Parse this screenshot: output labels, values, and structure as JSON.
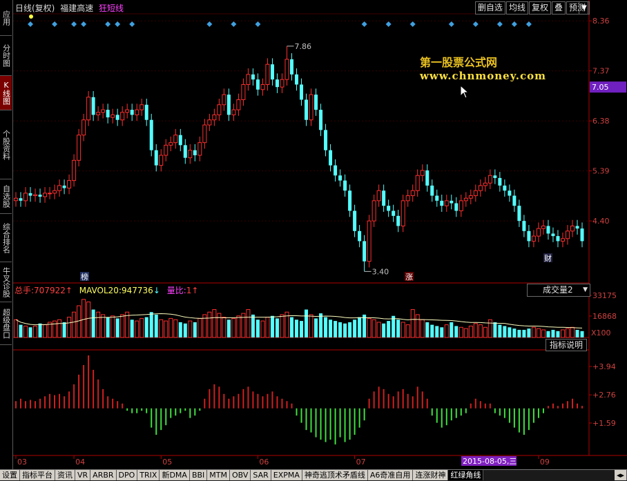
{
  "header": {
    "period": "日线(复权)",
    "stock": "福建高速",
    "indicator": "狂短线",
    "indicator_color": "#ff40ff"
  },
  "toolbar": [
    "删自选",
    "均线",
    "复权",
    "叠",
    "预测"
  ],
  "leftnav": [
    {
      "label": "应用",
      "active": false
    },
    {
      "label": "分时图",
      "active": false
    },
    {
      "label": "K线图",
      "active": true
    },
    {
      "label": "个股资料",
      "active": false
    },
    {
      "label": "自选股",
      "active": false
    },
    {
      "label": "综合排名",
      "active": false
    },
    {
      "label": "牛叉诊股",
      "active": false
    },
    {
      "label": "超级盘口",
      "active": false
    }
  ],
  "watermark": {
    "line1": "第一股票公式网",
    "line2": "www.chnmoney.com"
  },
  "price_axis": [
    "8.36",
    "7.37",
    "6.38",
    "5.39",
    "4.40"
  ],
  "current_price": "7.05",
  "annotations": {
    "high": "7.86",
    "low": "3.40",
    "tag_bang": "榜",
    "tag_zhang": "涨",
    "tag_cai": "财"
  },
  "volume_panel": {
    "total_label": "总手:",
    "total_value": "707922",
    "mavol_label": "MAVOL20:",
    "mavol_value": "947736",
    "ratio_label": "量比:",
    "ratio_value": "1",
    "selector": "成交量2",
    "axis": [
      "33175",
      "16868"
    ],
    "unit": "X100",
    "help_button": "指标说明"
  },
  "indicator_axis": [
    "+3.94",
    "+2.76",
    "+1.59"
  ],
  "x_axis": [
    "03",
    "04",
    "05",
    "06",
    "07",
    "08",
    "09"
  ],
  "cursor_date": "2015-08-05,三",
  "tabs": [
    {
      "label": "设置",
      "active": false
    },
    {
      "label": "指标平台",
      "active": false
    },
    {
      "label": "资讯",
      "active": false
    },
    {
      "label": "VR",
      "active": false
    },
    {
      "label": "ARBR",
      "active": false
    },
    {
      "label": "DPO",
      "active": false
    },
    {
      "label": "TRIX",
      "active": false
    },
    {
      "label": "新DMA",
      "active": false
    },
    {
      "label": "BBI",
      "active": false
    },
    {
      "label": "MTM",
      "active": false
    },
    {
      "label": "OBV",
      "active": false
    },
    {
      "label": "SAR",
      "active": false
    },
    {
      "label": "EXPMA",
      "active": false
    },
    {
      "label": "神奇逃顶术矛盾线",
      "active": false
    },
    {
      "label": "A6奇准自用",
      "active": false
    },
    {
      "label": "连涨财神",
      "active": false
    },
    {
      "label": "红绿角线",
      "active": true
    }
  ],
  "colors": {
    "up": "#ff3030",
    "down": "#54ffff",
    "axis": "#b00000",
    "macd_up": "#d02020",
    "macd_down": "#40e040",
    "diamond": "#40a0e0",
    "ma_line": "#ffffc0"
  },
  "chart_data": {
    "type": "candlestick",
    "ylim": [
      3.2,
      8.5
    ],
    "price_ticks": [
      8.36,
      7.37,
      6.38,
      5.39,
      4.4
    ],
    "high": 7.86,
    "low": 3.4,
    "close_series": [
      4.85,
      4.8,
      4.95,
      4.9,
      4.92,
      4.88,
      4.95,
      4.95,
      5.0,
      5.1,
      5.05,
      5.2,
      5.6,
      6.1,
      6.4,
      6.85,
      6.5,
      6.55,
      6.6,
      6.45,
      6.5,
      6.4,
      6.55,
      6.6,
      6.5,
      6.6,
      6.7,
      6.4,
      5.8,
      5.5,
      5.7,
      5.9,
      5.95,
      6.1,
      5.9,
      5.65,
      5.8,
      5.7,
      5.95,
      6.3,
      6.4,
      6.5,
      6.7,
      6.9,
      6.5,
      6.6,
      6.8,
      7.1,
      7.3,
      7.2,
      7.0,
      7.1,
      7.5,
      7.2,
      7.05,
      7.2,
      7.6,
      7.3,
      7.1,
      6.8,
      6.4,
      6.9,
      6.6,
      6.2,
      5.8,
      5.5,
      5.3,
      5.2,
      5.0,
      4.6,
      4.2,
      4.0,
      3.6,
      4.4,
      4.8,
      5.0,
      4.7,
      4.6,
      4.5,
      4.3,
      4.8,
      4.9,
      5.0,
      5.3,
      5.4,
      5.1,
      4.9,
      4.8,
      4.7,
      4.8,
      4.75,
      4.6,
      4.8,
      4.85,
      4.9,
      5.0,
      5.1,
      5.15,
      5.3,
      5.25,
      5.1,
      5.0,
      4.9,
      4.7,
      4.4,
      4.2,
      4.0,
      4.1,
      4.25,
      4.3,
      4.15,
      4.1,
      4.0,
      4.05,
      4.2,
      4.3,
      4.25,
      4.0
    ],
    "volume_ylim": [
      0,
      33175
    ],
    "volume_ticks": [
      33175,
      16868
    ],
    "volume_series": [
      14,
      10,
      9,
      8,
      9,
      11,
      10,
      12,
      13,
      14,
      12,
      16,
      20,
      25,
      30,
      28,
      22,
      20,
      18,
      16,
      17,
      15,
      18,
      20,
      14,
      13,
      15,
      16,
      20,
      18,
      14,
      13,
      15,
      14,
      12,
      11,
      13,
      12,
      15,
      18,
      20,
      22,
      19,
      16,
      14,
      15,
      17,
      19,
      22,
      18,
      14,
      13,
      16,
      17,
      15,
      18,
      20,
      16,
      14,
      13,
      22,
      18,
      15,
      19,
      16,
      14,
      13,
      12,
      11,
      12,
      14,
      16,
      18,
      15,
      14,
      12,
      11,
      13,
      17,
      14,
      12,
      10,
      22,
      18,
      14,
      12,
      10,
      9,
      8,
      10,
      12,
      9,
      8,
      7,
      9,
      11,
      10,
      8,
      14,
      12,
      10,
      9,
      8,
      7,
      6,
      6,
      7,
      8,
      7,
      6,
      5,
      6,
      5,
      6,
      7,
      8,
      6,
      5
    ],
    "indicator_ticks": [
      3.94,
      2.76,
      1.59
    ],
    "indicator_series": [
      0.3,
      0.4,
      0.3,
      0.35,
      0.3,
      0.4,
      0.5,
      0.6,
      0.55,
      0.6,
      0.5,
      0.7,
      1.0,
      1.4,
      1.8,
      2.2,
      1.6,
      1.2,
      0.8,
      0.5,
      0.4,
      0.3,
      0.2,
      -0.1,
      -0.2,
      -0.2,
      -0.1,
      -0.2,
      -0.8,
      -1.1,
      -0.9,
      -0.7,
      -0.4,
      -0.3,
      -0.2,
      -0.1,
      -0.4,
      -0.3,
      -0.1,
      0.4,
      0.8,
      1.0,
      0.9,
      0.6,
      0.4,
      0.5,
      0.6,
      0.8,
      0.9,
      0.7,
      0.6,
      0.5,
      0.6,
      0.7,
      0.5,
      0.4,
      0.3,
      0.2,
      -0.3,
      -0.6,
      -0.9,
      -1.0,
      -1.2,
      -1.3,
      -1.4,
      -1.3,
      -1.5,
      -1.2,
      -1.4,
      -1.3,
      -1.1,
      -0.8,
      -0.5,
      0.4,
      0.7,
      0.9,
      0.8,
      0.6,
      0.5,
      0.7,
      0.8,
      0.6,
      0.5,
      0.9,
      0.7,
      0.4,
      -0.3,
      -0.6,
      -0.8,
      -0.7,
      -0.5,
      -0.4,
      -0.3,
      -0.2,
      0.2,
      0.4,
      0.3,
      0.2,
      0.2,
      -0.2,
      -0.3,
      -0.4,
      -0.6,
      -0.8,
      -1.0,
      -1.1,
      -0.9,
      -0.6,
      -0.4,
      -0.2,
      0.1,
      0.2,
      0.1,
      0.2,
      0.3,
      0.4,
      0.2,
      0.1
    ]
  }
}
